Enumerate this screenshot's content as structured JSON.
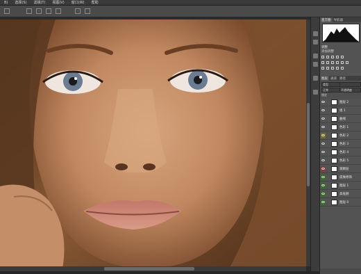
{
  "menubar": {
    "items": [
      "B)",
      "选择(S)",
      "滤镜(T)",
      "视图(V)",
      "窗口(W)",
      "帮助"
    ]
  },
  "canvas": {
    "subject": "close-up portrait photo"
  },
  "right_panel": {
    "tabs": [
      "直方图",
      "导航器"
    ],
    "adjustments": {
      "title": "调整",
      "subtitle": "添加调整"
    },
    "layer_tabs": [
      "图层",
      "通道",
      "路径"
    ],
    "controls": {
      "kind": "类型",
      "blend": "正常",
      "opacity": "不透明度",
      "fill": "填充",
      "lock": "锁定"
    },
    "layers": [
      {
        "name": "图层 2",
        "color": ""
      },
      {
        "name": "组 1",
        "color": ""
      },
      {
        "name": "曲线",
        "color": ""
      },
      {
        "name": "色彩 1",
        "color": ""
      },
      {
        "name": "色彩 2",
        "color": "#7a6a2a"
      },
      {
        "name": "色彩 3",
        "color": ""
      },
      {
        "name": "色彩 4",
        "color": ""
      },
      {
        "name": "色彩 5",
        "color": ""
      },
      {
        "name": "观察层",
        "color": "#8a3a3a"
      },
      {
        "name": "皮肤修饰",
        "color": "#3a6a2a"
      },
      {
        "name": "图层 1",
        "color": "#3a6a2a"
      },
      {
        "name": "高低频",
        "color": "#3a6a2a"
      },
      {
        "name": "图层 0",
        "color": "#3a6a2a"
      }
    ]
  }
}
